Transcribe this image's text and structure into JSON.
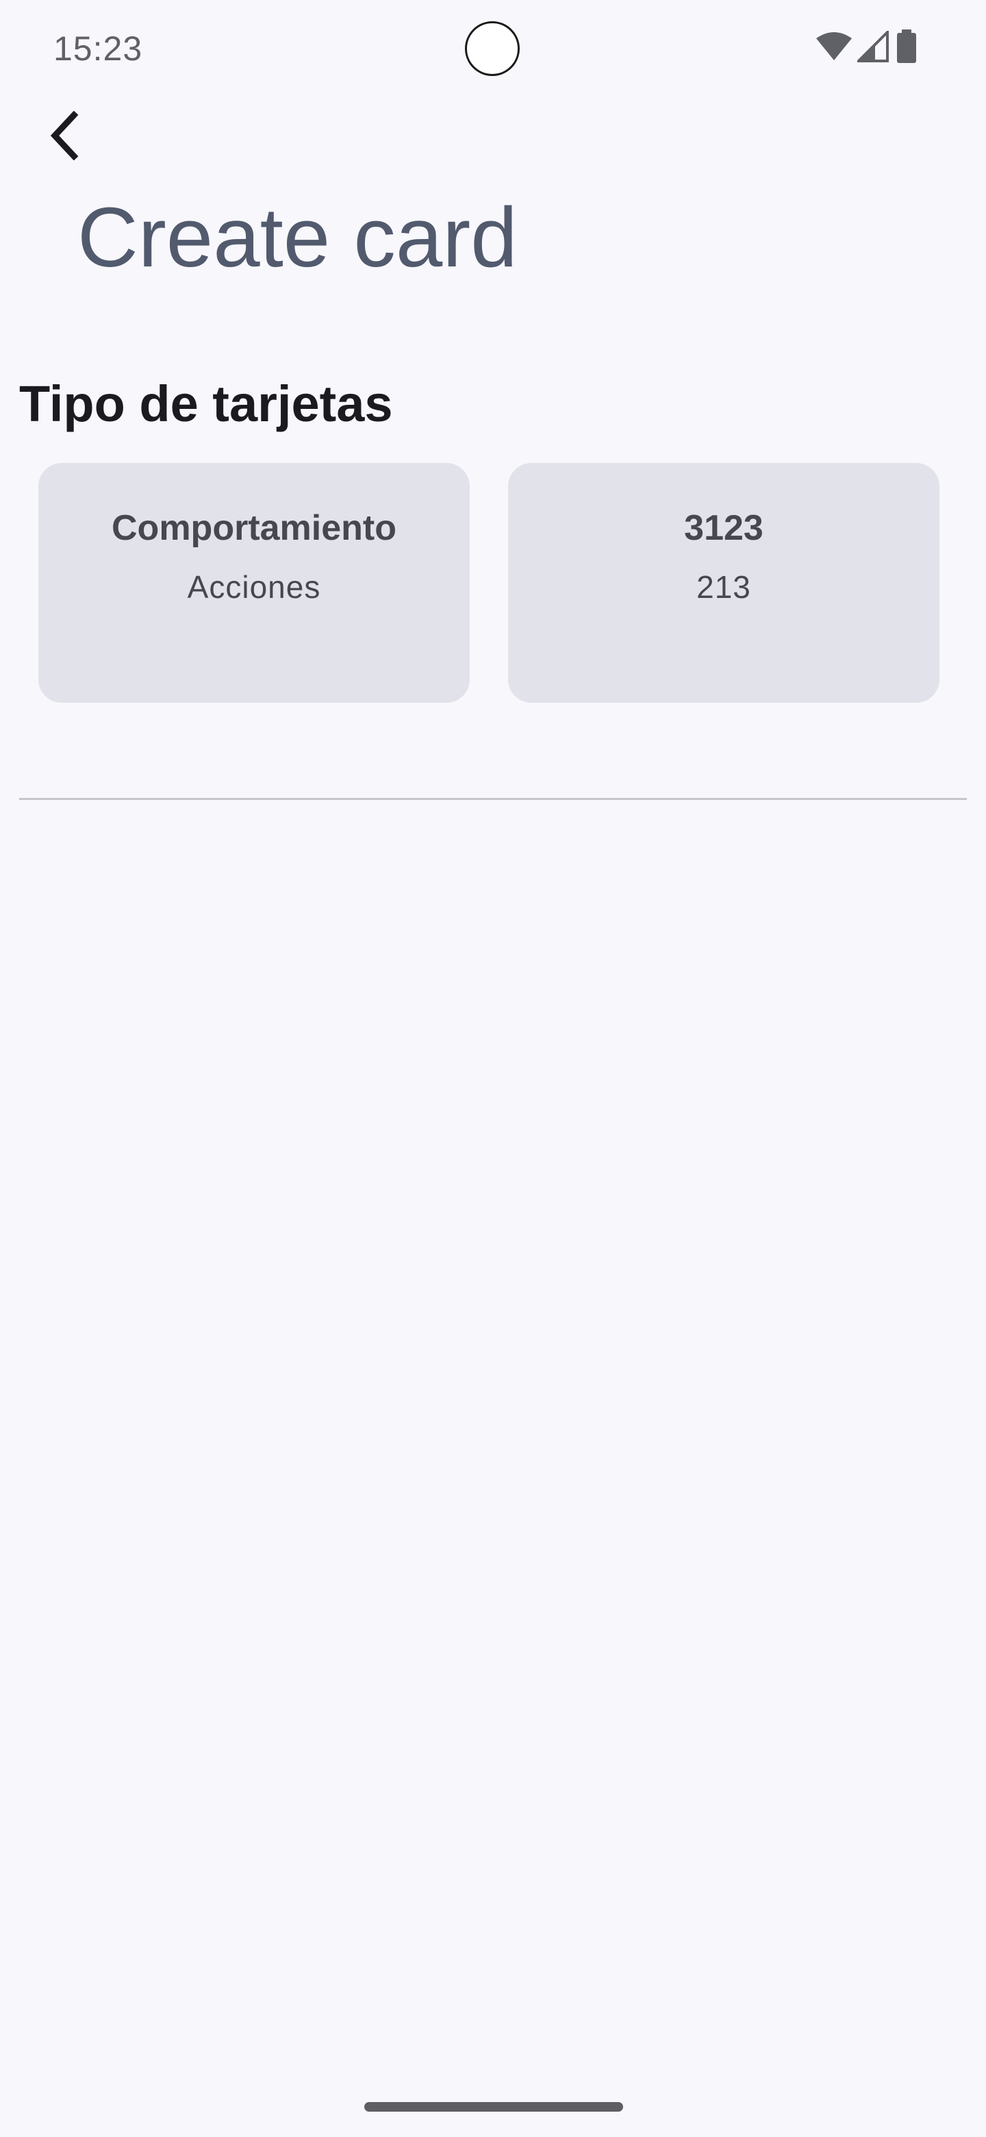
{
  "status_bar": {
    "time": "15:23",
    "icons": [
      "wifi-icon",
      "signal-icon",
      "battery-icon"
    ]
  },
  "header": {
    "back_icon": "chevron-left-icon",
    "title": "Create card"
  },
  "section": {
    "title": "Tipo de tarjetas"
  },
  "cards": [
    {
      "title": "Comportamiento",
      "subtitle": "Acciones"
    },
    {
      "title": "3123",
      "subtitle": "213"
    }
  ],
  "colors": {
    "background": "#f8f7fc",
    "card": "#e2e2ea",
    "title": "#525a6e",
    "text_dark": "#1b1b1f"
  }
}
